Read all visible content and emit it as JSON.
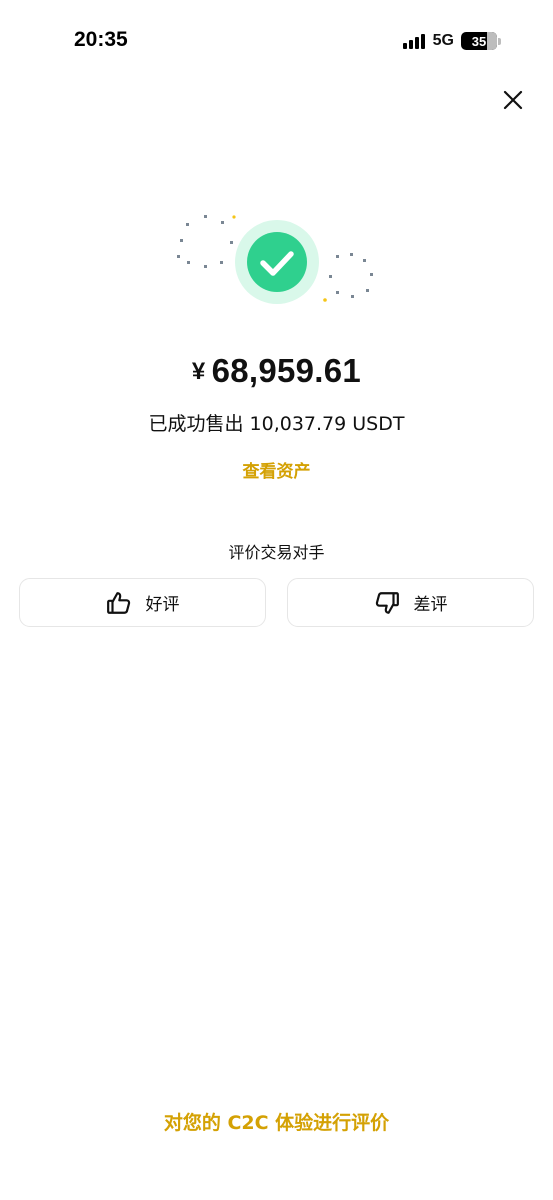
{
  "status_bar": {
    "time": "20:35",
    "network": "5G",
    "battery": "35",
    "icons": [
      "cellular-signal-icon",
      "battery-icon"
    ]
  },
  "header": {
    "close_icon": "close-icon"
  },
  "result": {
    "icon": "checkmark-success-icon",
    "currency_symbol": "¥",
    "amount": "68,959.61",
    "sold_text": "已成功售出 10,037.79 USDT",
    "view_assets_label": "查看资产"
  },
  "rating": {
    "title": "评价交易对手",
    "good_label": "好评",
    "good_icon": "thumbs-up-icon",
    "bad_label": "差评",
    "bad_icon": "thumbs-down-icon"
  },
  "footer": {
    "feedback_label": "对您的 C2C 体验进行评价"
  },
  "colors": {
    "accent": "#d4a104",
    "success": "#2fd08e",
    "success_halo": "#d9f8ea"
  }
}
